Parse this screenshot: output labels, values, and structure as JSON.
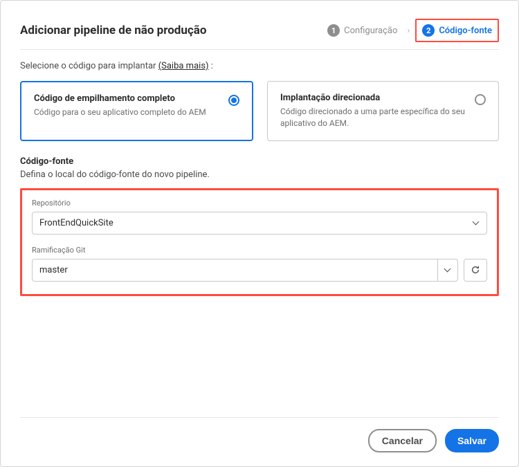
{
  "header": {
    "title": "Adicionar pipeline de não produção"
  },
  "stepper": {
    "step1": {
      "num": "1",
      "label": "Configuração"
    },
    "step2": {
      "num": "2",
      "label": "Código-fonte"
    }
  },
  "instruction": {
    "prefix": "Selecione o código para implantar ",
    "link": "(Saiba mais)",
    "suffix": " :"
  },
  "cards": {
    "full": {
      "title": "Código de empilhamento completo",
      "desc": "Código para o seu aplicativo completo do AEM"
    },
    "targeted": {
      "title": "Implantação direcionada",
      "desc": "Código direcionado a uma parte específica do seu aplicativo do AEM."
    }
  },
  "source": {
    "title": "Código-fonte",
    "subtitle": "Defina o local do código-fonte do novo pipeline."
  },
  "fields": {
    "repo": {
      "label": "Repositório",
      "value": "FrontEndQuickSite"
    },
    "branch": {
      "label": "Ramificação Git",
      "value": "master"
    }
  },
  "footer": {
    "cancel": "Cancelar",
    "save": "Salvar"
  }
}
